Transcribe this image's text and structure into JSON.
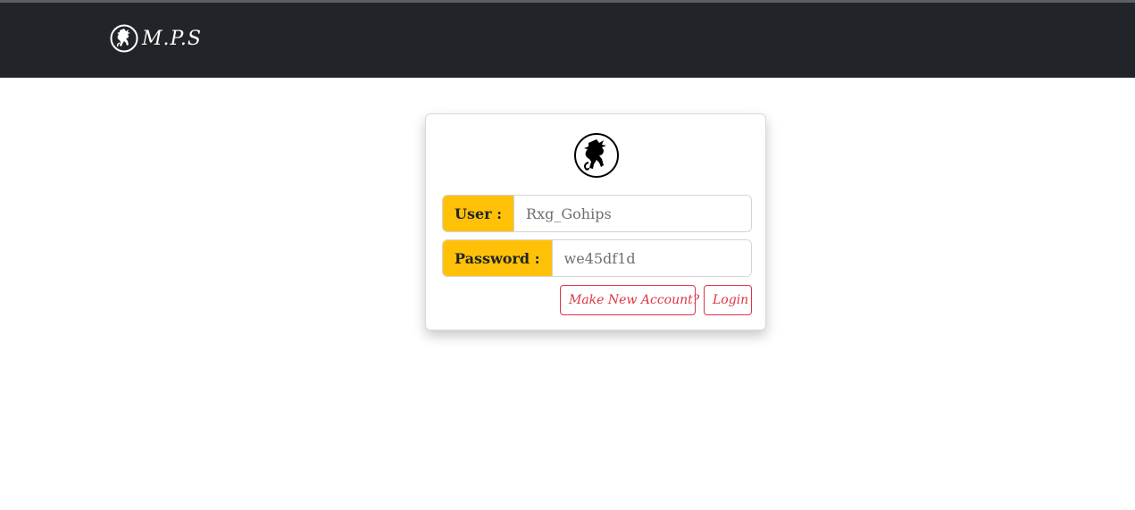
{
  "navbar": {
    "brand_text": "M.P.S",
    "brand_icon": "goku-silhouette-icon",
    "background": "#212529"
  },
  "login_card": {
    "logo_icon": "goku-silhouette-icon",
    "user": {
      "label": "User :",
      "value": "Rxg_Gohips"
    },
    "password": {
      "label": "Password :",
      "value": "we45df1d"
    },
    "make_account_label": "Make New Account?",
    "login_label": "Login"
  },
  "colors": {
    "label_background": "#ffc107",
    "button_accent": "#dc3545"
  }
}
